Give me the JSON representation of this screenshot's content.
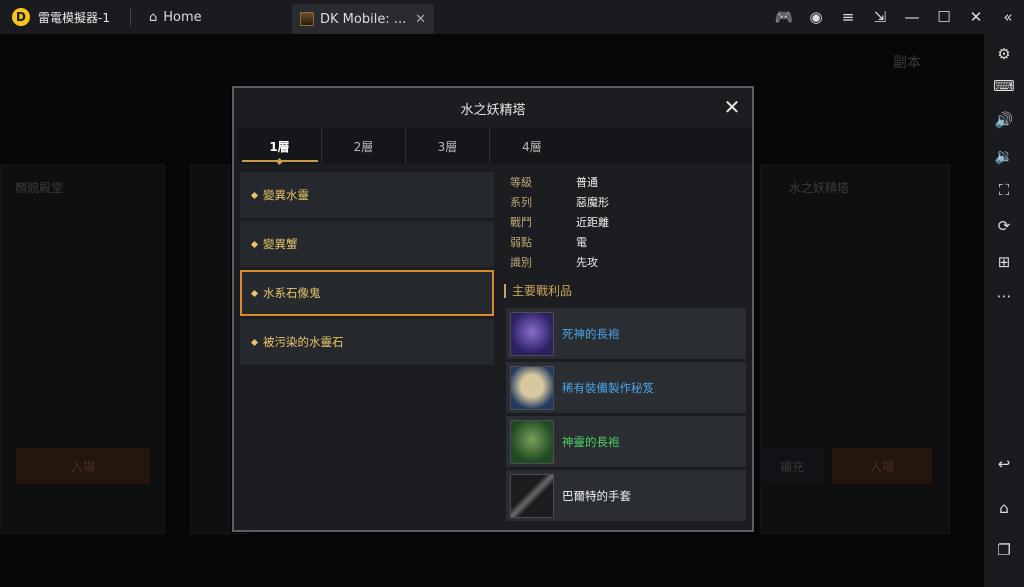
{
  "titlebar": {
    "app_title": "雷電模擬器-1",
    "home_tab": "Home",
    "game_tab": "DK Mobile: ...",
    "close": "✕",
    "icons": [
      "gamepad-icon",
      "account-icon",
      "menu-icon",
      "restore-icon",
      "minimize-icon",
      "maximize-icon",
      "close-icon",
      "collapse-icon"
    ]
  },
  "sidebar": {
    "icons": [
      "settings-icon",
      "keyboard-icon",
      "volume-up-icon",
      "volume-down-icon",
      "screenshot-icon",
      "sync-icon",
      "add-window-icon",
      "more-icon",
      "back-icon",
      "home-icon",
      "recents-icon"
    ]
  },
  "dialog": {
    "title": "水之妖精塔",
    "close": "✕",
    "floors": [
      "1層",
      "2層",
      "3層",
      "4層"
    ],
    "active_floor": 0,
    "monsters": [
      "變異水靈",
      "變異蟹",
      "水系石像鬼",
      "被污染的水靈石"
    ],
    "selected_monster": 2,
    "info": [
      {
        "label": "等級",
        "value": "普通"
      },
      {
        "label": "系列",
        "value": "惡魔形"
      },
      {
        "label": "戰鬥",
        "value": "近距離"
      },
      {
        "label": "弱點",
        "value": "電"
      },
      {
        "label": "識別",
        "value": "先攻"
      }
    ],
    "loot_title": "主要戰利品",
    "loot": [
      {
        "name": "死神的長袍",
        "color": "#4aa3e8",
        "thumb_bg": "#2a2060"
      },
      {
        "name": "稀有裝備製作秘笈",
        "color": "#4aa3e8",
        "thumb_bg": "#203a60"
      },
      {
        "name": "神靈的長袍",
        "color": "#4cd064",
        "thumb_bg": "#1f4a22"
      },
      {
        "name": "巴爾特的手套",
        "color": "#f0f0f0",
        "thumb_bg": "#1c1c1e"
      }
    ]
  },
  "background": {
    "left_card_title": "顏貌殿堂",
    "right_card_title": "水之妖精塔",
    "btn_left": "入場",
    "btn_right": "入場",
    "btn_mid": "補充",
    "header_right": "副本"
  }
}
